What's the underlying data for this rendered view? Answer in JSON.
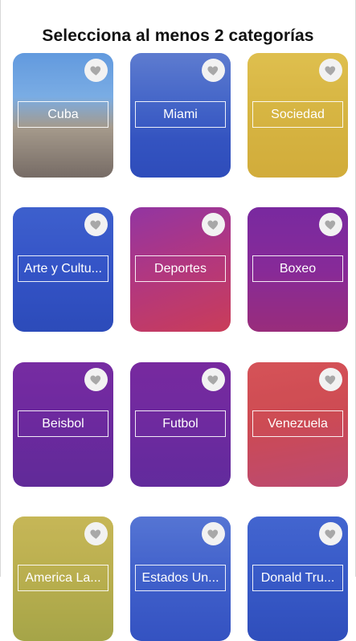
{
  "header": {
    "title": "Selecciona al menos 2 categorías"
  },
  "categories": [
    {
      "label": "Cuba"
    },
    {
      "label": "Miami"
    },
    {
      "label": "Sociedad"
    },
    {
      "label": "Arte y Cultu..."
    },
    {
      "label": "Deportes"
    },
    {
      "label": "Boxeo"
    },
    {
      "label": "Beisbol"
    },
    {
      "label": "Futbol"
    },
    {
      "label": "Venezuela"
    },
    {
      "label": "America La..."
    },
    {
      "label": "Estados Un..."
    },
    {
      "label": "Donald Tru..."
    }
  ],
  "colors": {
    "blue_tint": "#2f4fb8",
    "yellow_tint": "#d8b53a",
    "purple_tint": "#7a2aa0",
    "magenta_tint": "#b0306f",
    "red_tint": "#c9474f",
    "heart_icon": "#a8a8a8"
  },
  "icons": {
    "favorite": "heart-icon"
  }
}
